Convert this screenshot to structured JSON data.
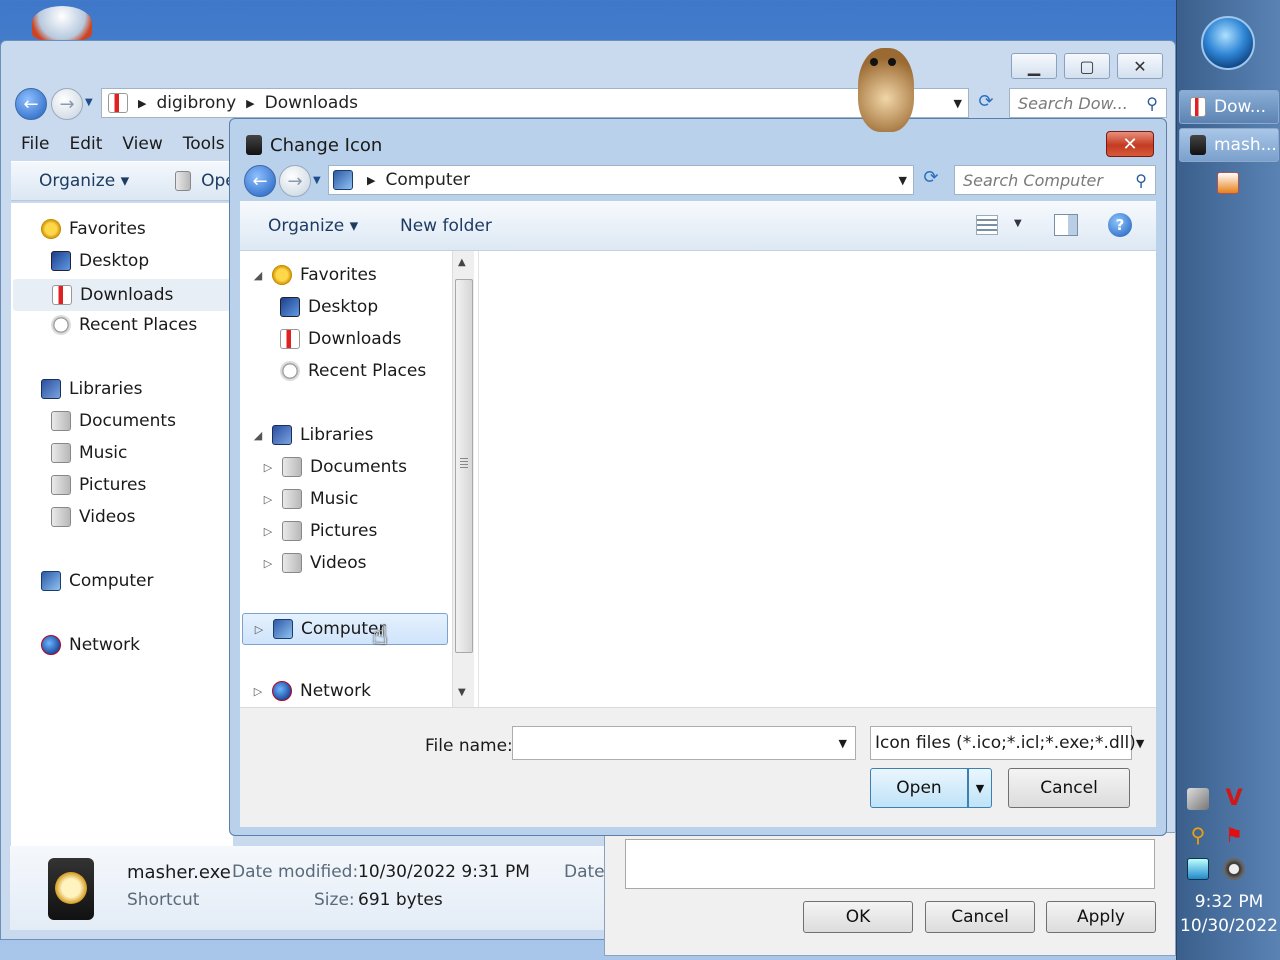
{
  "explorer": {
    "address": {
      "segments": [
        "digibrony",
        "Downloads"
      ]
    },
    "search_placeholder": "Search Dow...",
    "menu": [
      "File",
      "Edit",
      "View",
      "Tools",
      "H"
    ],
    "toolbar": {
      "organize": "Organize",
      "open": "Ope"
    },
    "nav": {
      "favorites": "Favorites",
      "desktop": "Desktop",
      "downloads": "Downloads",
      "recent": "Recent Places",
      "libraries": "Libraries",
      "documents": "Documents",
      "music": "Music",
      "pictures": "Pictures",
      "videos": "Videos",
      "computer": "Computer",
      "network": "Network"
    },
    "details": {
      "filename": "masher.exe",
      "type": "Shortcut",
      "modified_label": "Date modified:",
      "modified_value": "10/30/2022 9:31 PM",
      "size_label": "Size:",
      "size_value": "691 bytes",
      "date_cut": "Date"
    }
  },
  "properties": {
    "ok": "OK",
    "cancel": "Cancel",
    "apply": "Apply"
  },
  "dialog": {
    "title": "Change Icon",
    "close_glyph": "✕",
    "address": "Computer",
    "search_placeholder": "Search Computer",
    "toolbar": {
      "organize": "Organize",
      "new_folder": "New folder"
    },
    "nav": {
      "favorites": "Favorites",
      "desktop": "Desktop",
      "downloads": "Downloads",
      "recent": "Recent Places",
      "libraries": "Libraries",
      "documents": "Documents",
      "music": "Music",
      "pictures": "Pictures",
      "videos": "Videos",
      "computer": "Computer",
      "network": "Network"
    },
    "file_name_label": "File name:",
    "file_name_value": "",
    "filter": "Icon files (*.ico;*.icl;*.exe;*.dll)",
    "open": "Open",
    "cancel": "Cancel"
  },
  "taskbar": {
    "items": [
      "Dow...",
      "mash..."
    ],
    "time": "9:32 PM",
    "date": "10/30/2022"
  }
}
